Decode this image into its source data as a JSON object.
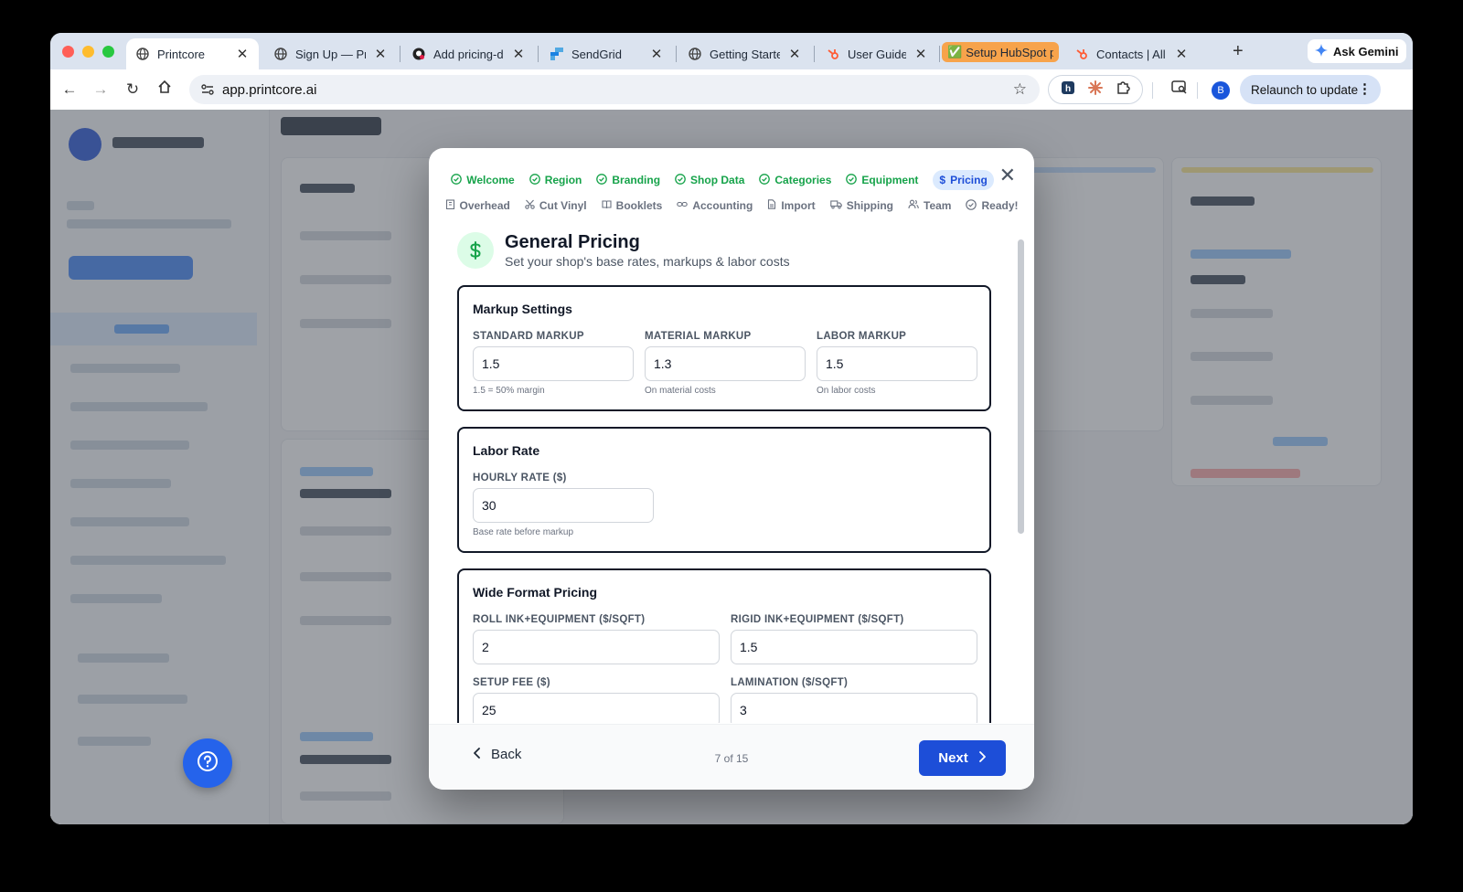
{
  "browser": {
    "tabs": [
      {
        "title": "Printcore",
        "active": true
      },
      {
        "title": "Sign Up — Pri"
      },
      {
        "title": "Add pricing-d"
      },
      {
        "title": "SendGrid"
      },
      {
        "title": "Getting Starte"
      },
      {
        "title": "User Guide | H"
      },
      {
        "title": "Setup HubSpot pi",
        "prefix": "✅",
        "highlight_color": "#f7a34b"
      },
      {
        "title": "Contacts | All"
      }
    ],
    "ask_gemini": "Ask Gemini",
    "url": "app.printcore.ai",
    "profile_initial": "B",
    "relaunch_label": "Relaunch to update"
  },
  "wizard": {
    "steps_row1": [
      {
        "label": "Welcome",
        "state": "done"
      },
      {
        "label": "Region",
        "state": "done"
      },
      {
        "label": "Branding",
        "state": "done"
      },
      {
        "label": "Shop Data",
        "state": "done"
      },
      {
        "label": "Categories",
        "state": "done"
      },
      {
        "label": "Equipment",
        "state": "done"
      },
      {
        "label": "Pricing",
        "state": "current"
      }
    ],
    "steps_row2": [
      {
        "label": "Overhead",
        "icon": "building-icon"
      },
      {
        "label": "Cut Vinyl",
        "icon": "scissors-icon"
      },
      {
        "label": "Booklets",
        "icon": "book-icon"
      },
      {
        "label": "Accounting",
        "icon": "link-icon"
      },
      {
        "label": "Import",
        "icon": "file-icon"
      },
      {
        "label": "Shipping",
        "icon": "truck-icon"
      },
      {
        "label": "Team",
        "icon": "users-icon"
      },
      {
        "label": "Ready!",
        "icon": "check-circle-icon"
      }
    ],
    "title": "General Pricing",
    "subtitle": "Set your shop's base rates, markups & labor costs",
    "markup": {
      "title": "Markup Settings",
      "standard": {
        "label": "STANDARD MARKUP",
        "value": "1.5",
        "hint": "1.5 = 50% margin"
      },
      "material": {
        "label": "MATERIAL MARKUP",
        "value": "1.3",
        "hint": "On material costs"
      },
      "labor": {
        "label": "LABOR MARKUP",
        "value": "1.5",
        "hint": "On labor costs"
      }
    },
    "labor_rate": {
      "title": "Labor Rate",
      "hourly": {
        "label": "HOURLY RATE ($)",
        "value": "30",
        "hint": "Base rate before markup"
      }
    },
    "wide_format": {
      "title": "Wide Format Pricing",
      "roll": {
        "label": "ROLL INK+EQUIPMENT ($/SQFT)",
        "value": "2"
      },
      "rigid": {
        "label": "RIGID INK+EQUIPMENT ($/SQFT)",
        "value": "1.5"
      },
      "setup": {
        "label": "SETUP FEE ($)",
        "value": "25"
      },
      "lamination": {
        "label": "LAMINATION ($/SQFT)",
        "value": "3"
      }
    },
    "footer": {
      "back_label": "Back",
      "step_count": "7 of 15",
      "next_label": "Next"
    }
  },
  "colors": {
    "primary": "#1d4ed8",
    "done_green": "#16a34a",
    "current_bg": "#dbeafe",
    "fab_blue": "#2563eb"
  }
}
